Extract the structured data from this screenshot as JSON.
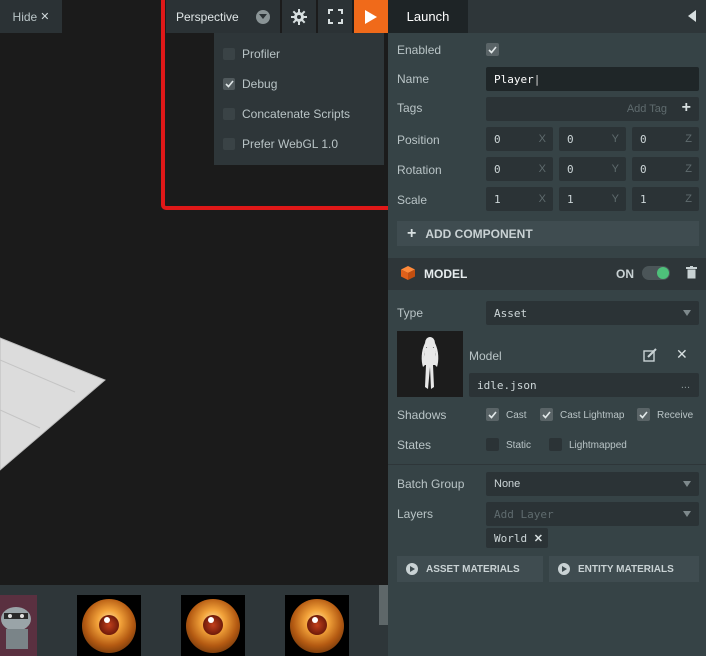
{
  "viewport": {
    "hide_label": "Hide",
    "camera": "Perspective",
    "launch_menu": [
      {
        "label": "Profiler",
        "checked": false
      },
      {
        "label": "Debug",
        "checked": true
      },
      {
        "label": "Concatenate Scripts",
        "checked": false
      },
      {
        "label": "Prefer WebGL 1.0",
        "checked": false
      }
    ],
    "icons": [
      "gear-icon",
      "fullscreen-icon",
      "play-icon",
      "chevron-down-icon",
      "close-icon"
    ],
    "highlight_color": "#e01818",
    "play_color": "#f06a1a"
  },
  "inspector": {
    "launch_tab": "Launch",
    "enabled_label": "Enabled",
    "name_label": "Name",
    "name_value": "Player",
    "tags_label": "Tags",
    "tags_placeholder": "Add Tag",
    "position_label": "Position",
    "rotation_label": "Rotation",
    "scale_label": "Scale",
    "position": [
      "0",
      "0",
      "0"
    ],
    "rotation": [
      "0",
      "0",
      "0"
    ],
    "scale": [
      "1",
      "1",
      "1"
    ],
    "axes": [
      "X",
      "Y",
      "Z"
    ],
    "add_component": "ADD COMPONENT",
    "model": {
      "title": "MODEL",
      "on_label": "ON",
      "type_label": "Type",
      "type_value": "Asset",
      "model_label": "Model",
      "model_file": "idle.json",
      "more": "...",
      "shadows_label": "Shadows",
      "cast": "Cast",
      "cast_lightmap": "Cast Lightmap",
      "receive": "Receive",
      "states_label": "States",
      "static": "Static",
      "lightmapped": "Lightmapped",
      "batch_group_label": "Batch Group",
      "batch_group_value": "None",
      "layers_label": "Layers",
      "layers_placeholder": "Add Layer",
      "layer_tag": "World",
      "asset_materials": "ASSET MATERIALS",
      "entity_materials": "ENTITY MATERIALS"
    },
    "toggle_color": "#4ec07a",
    "model_icon_color": "#f06a1a"
  }
}
